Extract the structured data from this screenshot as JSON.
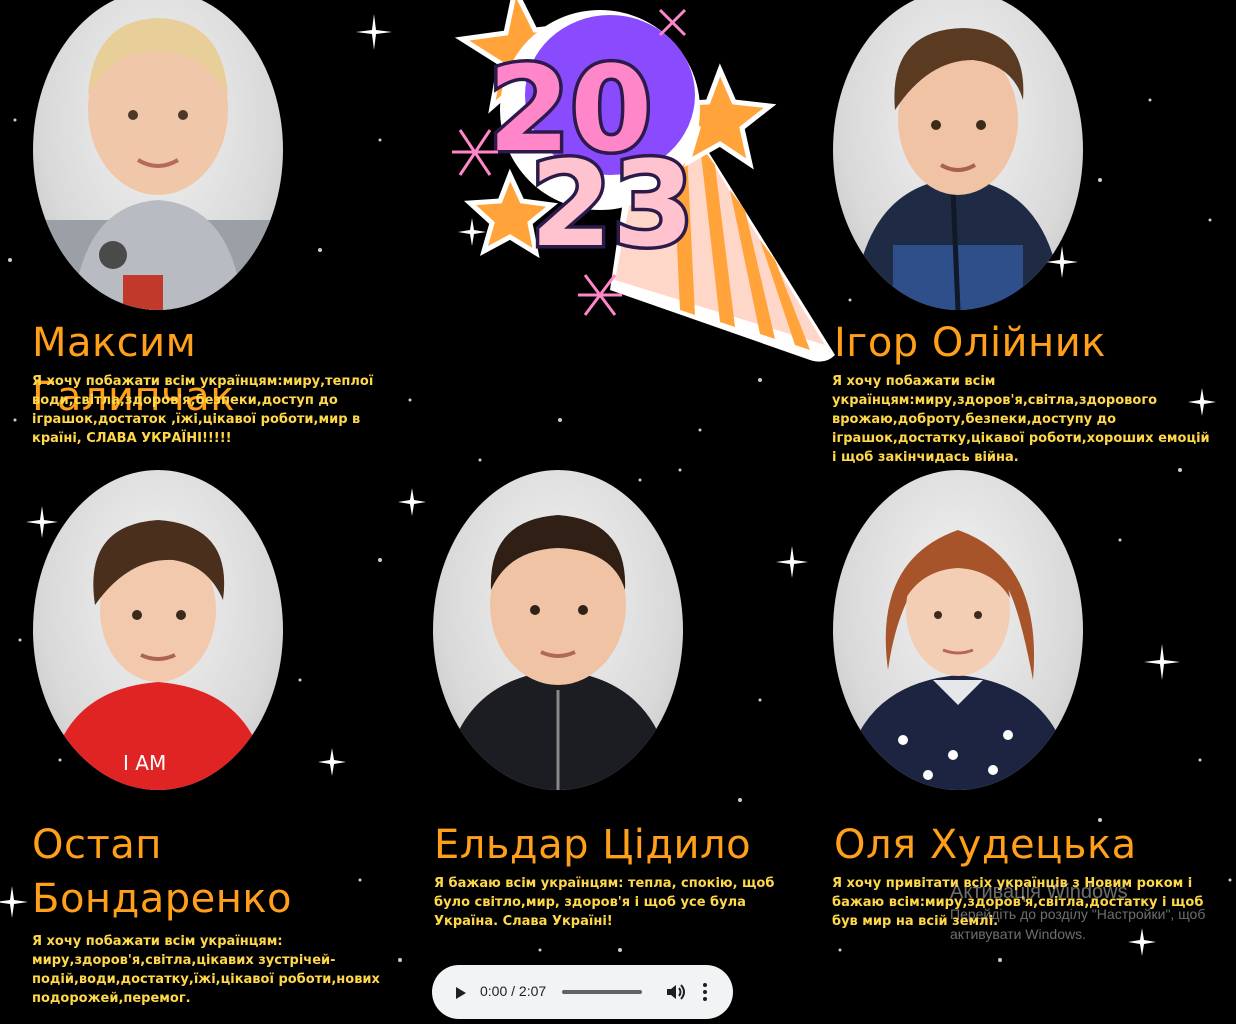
{
  "logo": {
    "year_top": "20",
    "year_bottom": "23"
  },
  "people": [
    {
      "name": "Максим Галипчак",
      "wish": "Я хочу побажати всім українцям:миру,теплої води,світла,здоров'я,безпеки,доступ до іграшок,достаток ,їжі,цікавої роботи,мир в країні, СЛАВА УКРАЇНІ!!!!!"
    },
    {
      "name": "Ігор Олійник",
      "wish": "Я хочу побажати всім українцям:миру,здоров'я,світла,здорового врожаю,доброту,безпеки,доступу до іграшок,достатку,цікавої роботи,хороших емоцій і щоб закінчидась війна."
    },
    {
      "name_line1": "Остап",
      "name_line2": "Бондаренко",
      "wish": "Я хочу побажати всім українцям: миру,здоров'я,світла,цікавих зустрічей-подій,води,достатку,їжі,цікавої роботи,нових подорожей,перемог."
    },
    {
      "name": "Ельдар Цідило",
      "wish": "Я бажаю всім українцям: тепла, спокію, щоб було світло,мир, здоров'я і щоб усе була Україна. Слава Україні!"
    },
    {
      "name": "Оля Худецька",
      "wish": "Я хочу привітати всіх українців з Новим роком і бажаю всім:миру,здоров'я,світла,достатку і щоб був мир на всій землі."
    }
  ],
  "audio": {
    "time": "0:00 / 2:07"
  },
  "windows_watermark": {
    "line1": "Активація Windows",
    "line2": "Перейдіть до розділу \"Настройки\", щоб",
    "line3": "активувати Windows."
  },
  "colors": {
    "name": "#ff9f1a",
    "wish": "#ffd84a",
    "background": "#000000"
  }
}
